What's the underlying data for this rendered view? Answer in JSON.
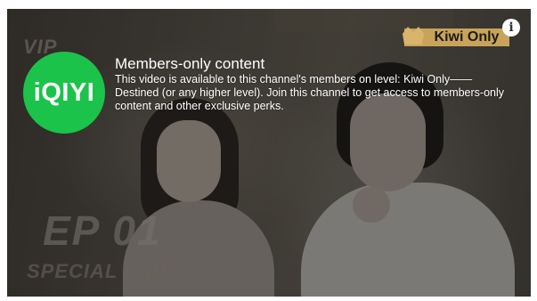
{
  "background": {
    "vip_text": "VIP",
    "episode_title": "EP 01",
    "episode_subtitle": "SPECIAL LADY"
  },
  "level_badge": {
    "label": "Kiwi Only",
    "color": "#c9a35a"
  },
  "info_button": {
    "icon": "info-icon",
    "glyph": "i"
  },
  "logo": {
    "text": "iQIYI",
    "color": "#1cc34a"
  },
  "message": {
    "title": "Members-only content",
    "body": "This video is available to this channel's members on level: Kiwi Only——Destined (or any higher level). Join this channel to get access to members-only content and other exclusive perks."
  }
}
